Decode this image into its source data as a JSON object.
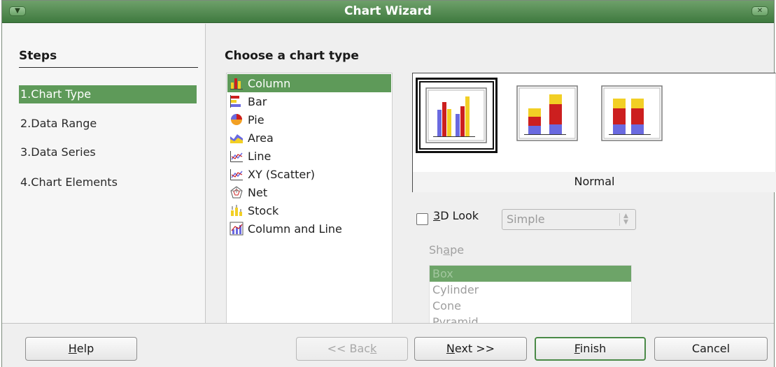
{
  "window": {
    "title": "Chart Wizard"
  },
  "steps": {
    "heading": "Steps",
    "items": [
      {
        "label": "1.Chart Type",
        "active": true
      },
      {
        "label": "2.Data Range",
        "active": false
      },
      {
        "label": "3.Data Series",
        "active": false
      },
      {
        "label": "4.Chart Elements",
        "active": false
      }
    ]
  },
  "main": {
    "heading": "Choose a chart type",
    "chart_types": [
      {
        "label": "Column",
        "icon": "column-chart-icon",
        "selected": true
      },
      {
        "label": "Bar",
        "icon": "bar-chart-icon",
        "selected": false
      },
      {
        "label": "Pie",
        "icon": "pie-chart-icon",
        "selected": false
      },
      {
        "label": "Area",
        "icon": "area-chart-icon",
        "selected": false
      },
      {
        "label": "Line",
        "icon": "line-chart-icon",
        "selected": false
      },
      {
        "label": "XY (Scatter)",
        "icon": "xy-scatter-chart-icon",
        "selected": false
      },
      {
        "label": "Net",
        "icon": "net-chart-icon",
        "selected": false
      },
      {
        "label": "Stock",
        "icon": "stock-chart-icon",
        "selected": false
      },
      {
        "label": "Column and Line",
        "icon": "column-and-line-chart-icon",
        "selected": false
      }
    ],
    "variant_label": "Normal",
    "variants": [
      {
        "icon": "column-normal-icon",
        "selected": true
      },
      {
        "icon": "column-stacked-icon",
        "selected": false
      },
      {
        "icon": "column-percent-stacked-icon",
        "selected": false
      }
    ],
    "look_3d": {
      "label_underlined": "3",
      "label_rest": "D Look",
      "checked": false,
      "select_value": "Simple"
    },
    "shape": {
      "label_before": "Sh",
      "label_underlined": "a",
      "label_after": "pe",
      "options": [
        "Box",
        "Cylinder",
        "Cone",
        "Pyramid"
      ],
      "selected": "Box"
    }
  },
  "buttons": {
    "help_u": "H",
    "help_rest": "elp",
    "back_pre": "<< Bac",
    "back_u": "k",
    "next_u": "N",
    "next_rest": "ext >>",
    "finish_u": "F",
    "finish_rest": "inish",
    "cancel": "Cancel"
  },
  "colors": {
    "accent_green": "#5e9a59",
    "titlebar_green": "#3f7a3f",
    "series_red": "#cc1f1f",
    "series_yellow": "#f2cf25",
    "series_blue": "#6a6ae0"
  }
}
